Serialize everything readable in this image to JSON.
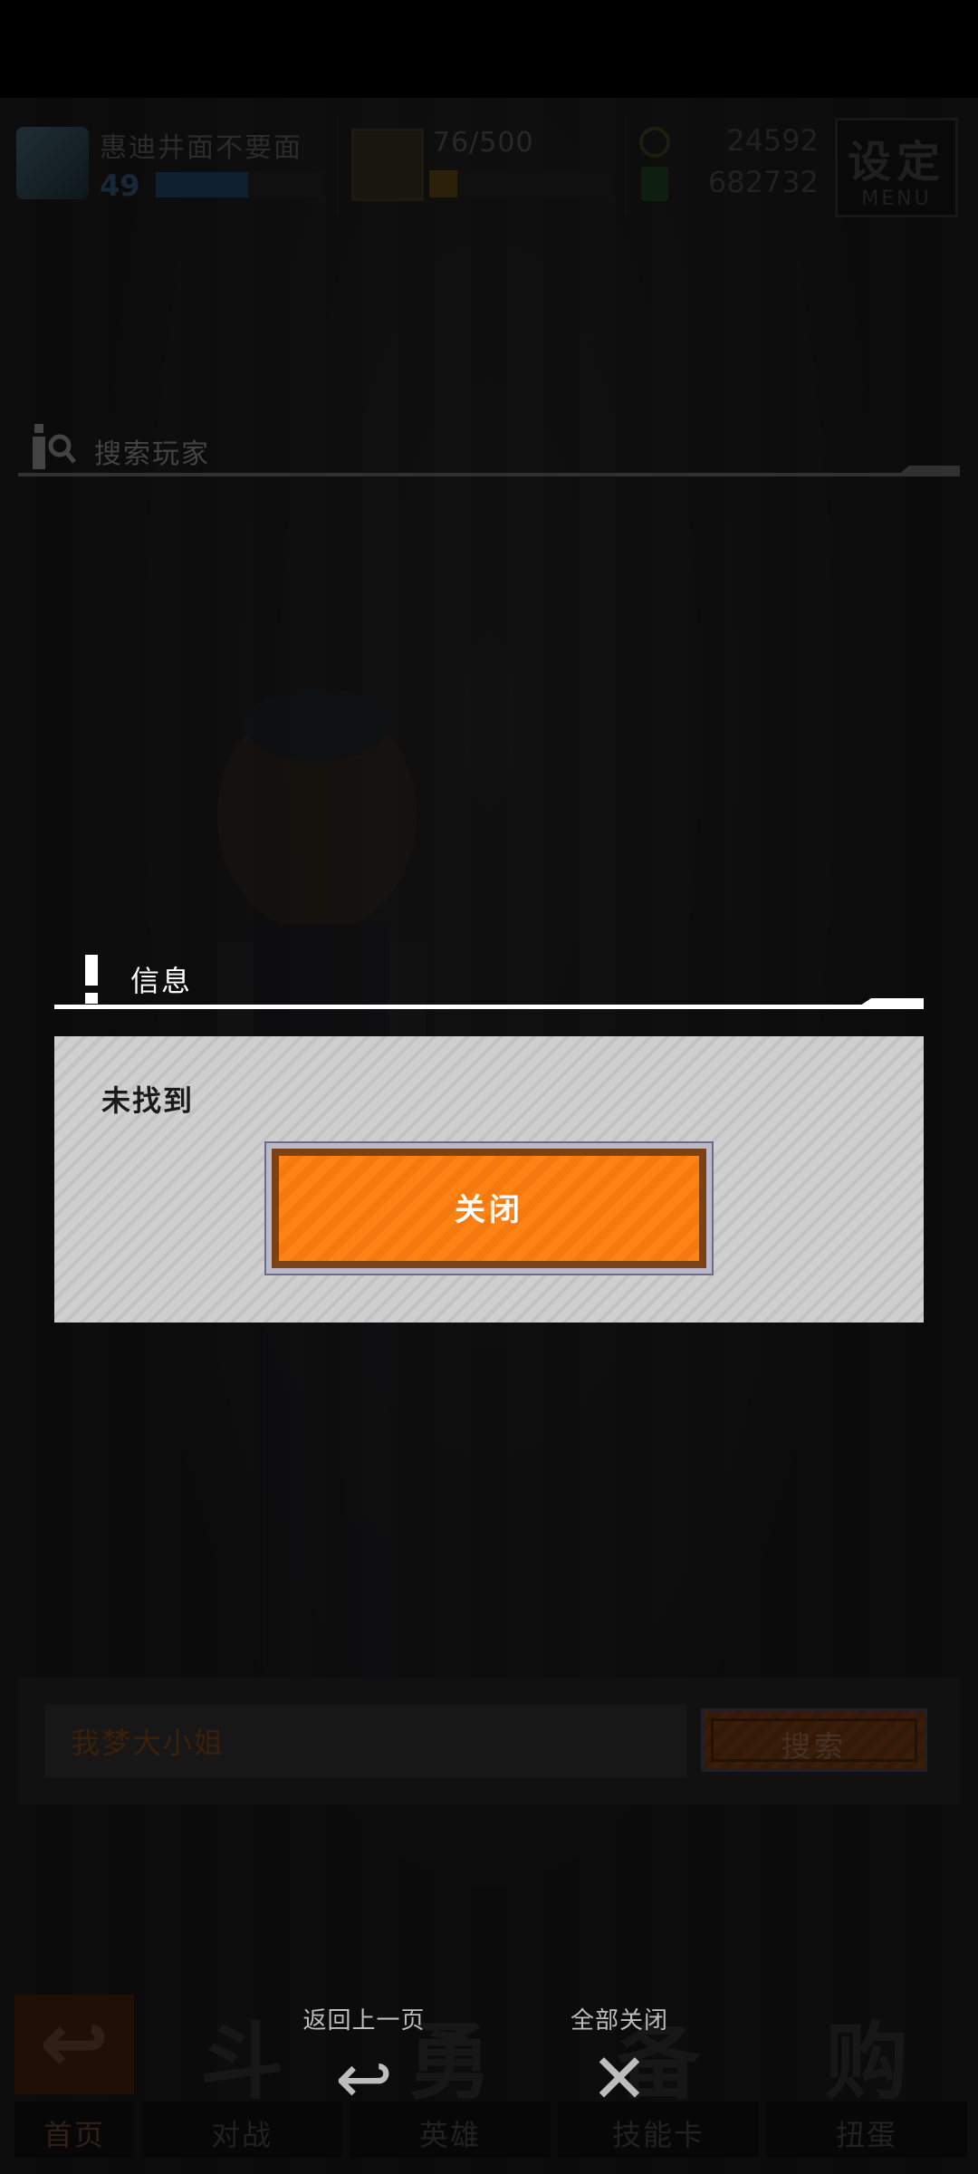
{
  "hud": {
    "player_name": "惠迪井面不要面",
    "level": "49",
    "xp_fraction": 0.55,
    "stamina": "76/500",
    "stamina_fraction": 0.15,
    "gold": "24592",
    "gems": "682732",
    "menu_title": "设定",
    "menu_sub": "MENU"
  },
  "section": {
    "title": "搜索玩家"
  },
  "search": {
    "input_value": "我梦大小姐",
    "button_label": "搜索"
  },
  "dialog": {
    "title": "信息",
    "message": "未找到",
    "close_label": "关闭"
  },
  "bottom_nav": {
    "items": [
      {
        "glyph": "↩",
        "label": "首页"
      },
      {
        "glyph": "斗",
        "label": "对战"
      },
      {
        "glyph": "勇",
        "label": "英雄"
      },
      {
        "glyph": "备",
        "label": "技能卡"
      },
      {
        "glyph": "购",
        "label": "扭蛋"
      }
    ],
    "back_label": "返回上一页",
    "back_icon": "↩",
    "close_all_label": "全部关闭",
    "close_all_icon": "✕"
  },
  "colors": {
    "accent_orange": "#ff8214",
    "dialog_bg": "#cfcfcf",
    "background": "#141414"
  }
}
